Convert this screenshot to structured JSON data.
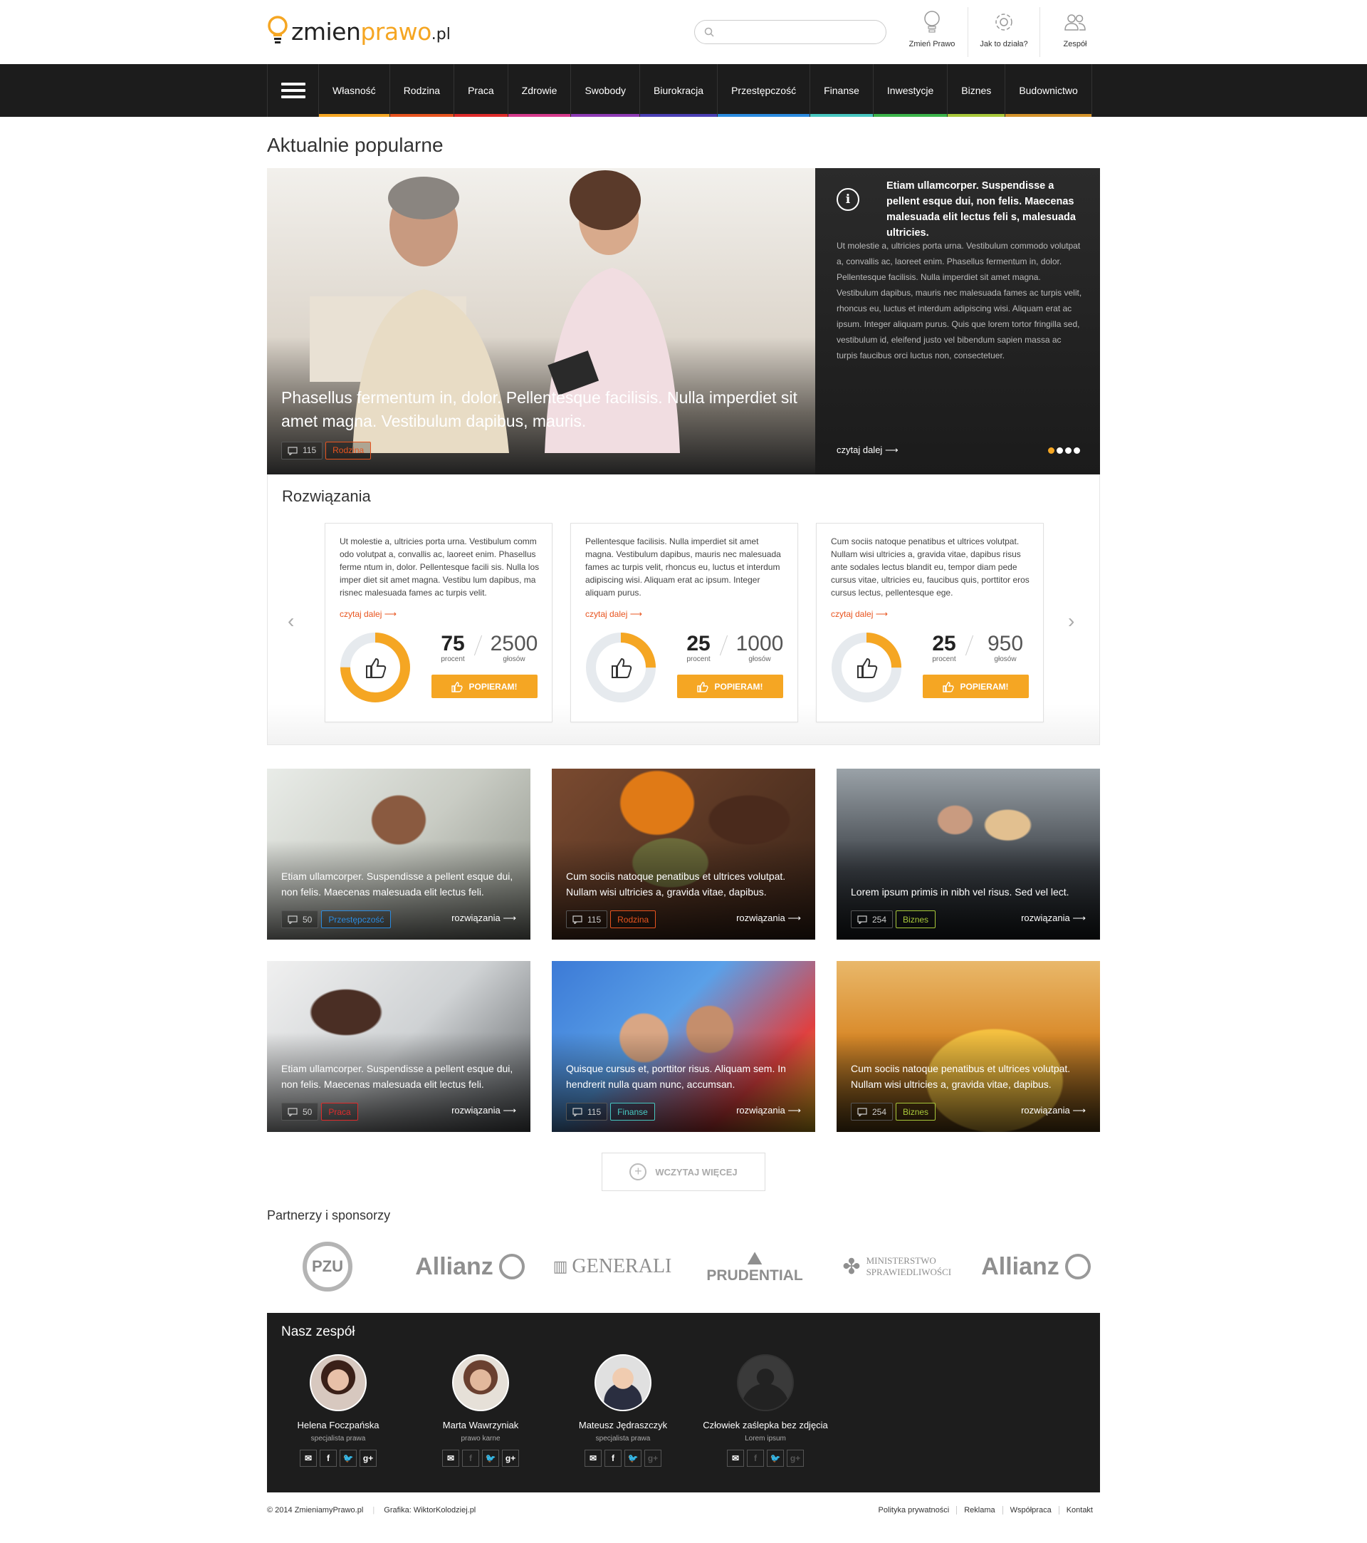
{
  "header": {
    "logo": {
      "part1": "zmien",
      "part2": "prawo",
      "part3": ".pl"
    },
    "search": {
      "placeholder": ""
    },
    "icons": [
      {
        "label": "Zmień Prawo",
        "icon": "lightbulb-icon"
      },
      {
        "label": "Jak to działa?",
        "icon": "gear-icon"
      },
      {
        "label": "Zespół",
        "icon": "people-icon"
      }
    ]
  },
  "nav": {
    "items": [
      {
        "label": "Własność",
        "color": "#f5a623"
      },
      {
        "label": "Rodzina",
        "color": "#e8541f"
      },
      {
        "label": "Praca",
        "color": "#e02b2b"
      },
      {
        "label": "Zdrowie",
        "color": "#d63a8c"
      },
      {
        "label": "Swobody",
        "color": "#8e3bb5"
      },
      {
        "label": "Biurokracja",
        "color": "#4b3fb5"
      },
      {
        "label": "Przestępczość",
        "color": "#2b8be0"
      },
      {
        "label": "Finanse",
        "color": "#47c7c0"
      },
      {
        "label": "Inwestycje",
        "color": "#3cb44a"
      },
      {
        "label": "Biznes",
        "color": "#a8c83a"
      },
      {
        "label": "Budownictwo",
        "color": "#d4932b"
      }
    ]
  },
  "popular": {
    "title": "Aktualnie popularne",
    "caption": "Phasellus fermentum in, dolor. Pellentesque facilisis. Nulla imperdiet sit amet magna. Vestibulum dapibus, mauris.",
    "comments": "115",
    "category": "Rodzina",
    "category_color": "#e8541f",
    "panel_title": "Etiam ullamcorper. Suspendisse a pellent esque dui, non felis. Maecenas malesuada elit lectus feli s, malesuada ultricies.",
    "panel_body": "Ut molestie a, ultricies porta urna. Vestibulum commodo volutpat a, convallis ac, laoreet enim. Phasellus fermentum in, dolor. Pellentesque facilisis. Nulla imperdiet sit amet magna. Vestibulum dapibus, mauris nec malesuada fames ac turpis velit, rhoncus eu, luctus et interdum adipiscing wisi. Aliquam erat ac ipsum. Integer aliquam purus. Quis que lorem tortor fringilla sed, vestibulum id, eleifend justo vel bibendum sapien massa ac turpis faucibus orci luctus non, consectetuer.",
    "read_more": "czytaj dalej"
  },
  "solutions": {
    "title": "Rozwiązania",
    "cards": [
      {
        "text": "Ut molestie a, ultricies porta urna. Vestibulum comm odo volutpat a, convallis ac, laoreet enim. Phasellus ferme ntum in, dolor. Pellentesque facili sis. Nulla los imper diet sit amet magna. Vestibu lum dapibus, ma risnec malesuada fames ac turpis velit.",
        "more": "czytaj dalej",
        "percent": "75",
        "percent_label": "procent",
        "votes": "2500",
        "votes_label": "głosów",
        "button": "POPIERAM!",
        "fill": 0.75
      },
      {
        "text": "Pellentesque facilisis. Nulla imperdiet sit amet magna. Vestibulum dapibus, mauris nec malesuada fames ac turpis velit, rhoncus eu, luctus et interdum adipiscing wisi. Aliquam erat ac ipsum. Integer aliquam purus.",
        "more": "czytaj dalej",
        "percent": "25",
        "percent_label": "procent",
        "votes": "1000",
        "votes_label": "głosów",
        "button": "POPIERAM!",
        "fill": 0.25
      },
      {
        "text": "Cum sociis natoque penatibus et ultrices volutpat. Nullam wisi ultricies a, gravida vitae, dapibus risus ante sodales lectus blandit eu, tempor diam pede cursus vitae, ultricies eu, faucibus quis, porttitor eros cursus lectus, pellentesque ege.",
        "more": "czytaj dalej",
        "percent": "25",
        "percent_label": "procent",
        "votes": "950",
        "votes_label": "głosów",
        "button": "POPIERAM!",
        "fill": 0.25
      }
    ]
  },
  "tiles": [
    {
      "title": "Etiam ullamcorper. Suspendisse a pellent esque dui, non felis. Maecenas malesuada elit lectus feli.",
      "comments": "50",
      "category": "Przestępczość",
      "color": "#2b8be0",
      "link": "rozwiązania"
    },
    {
      "title": "Cum sociis natoque penatibus et ultrices volutpat. Nullam wisi ultricies a, gravida vitae, dapibus.",
      "comments": "115",
      "category": "Rodzina",
      "color": "#e8541f",
      "link": "rozwiązania"
    },
    {
      "title": "Lorem ipsum primis in nibh vel risus. Sed vel lect.",
      "comments": "254",
      "category": "Biznes",
      "color": "#a8c83a",
      "link": "rozwiązania"
    },
    {
      "title": "Etiam ullamcorper. Suspendisse a pellent esque dui, non felis. Maecenas malesuada elit lectus feli.",
      "comments": "50",
      "category": "Praca",
      "color": "#e02b2b",
      "link": "rozwiązania"
    },
    {
      "title": "Quisque cursus et, porttitor risus. Aliquam sem. In hendrerit nulla quam nunc, accumsan.",
      "comments": "115",
      "category": "Finanse",
      "color": "#47c7c0",
      "link": "rozwiązania"
    },
    {
      "title": "Cum sociis natoque penatibus et ultrices volutpat. Nullam wisi ultricies a, gravida vitae, dapibus.",
      "comments": "254",
      "category": "Biznes",
      "color": "#a8c83a",
      "link": "rozwiązania"
    }
  ],
  "load_more": "WCZYTAJ WIĘCEJ",
  "partners": {
    "title": "Partnerzy i sponsorzy",
    "logos": [
      "PZU",
      "Allianz",
      "GENERALI",
      "PRUDENTIAL",
      "Ministerstwo Sprawiedliwości",
      "Allianz"
    ]
  },
  "team": {
    "title": "Nasz zespół",
    "members": [
      {
        "name": "Helena Foczpańska",
        "role": "specjalista prawa"
      },
      {
        "name": "Marta Wawrzyniak",
        "role": "prawo karne"
      },
      {
        "name": "Mateusz Jędraszczyk",
        "role": "specjalista prawa"
      },
      {
        "name": "Człowiek zaślepka bez zdjęcia",
        "role": "Lorem ipsum"
      }
    ]
  },
  "footer": {
    "copy": "© 2014 ZmieniamyPrawo.pl",
    "credit": "Grafika: WiktorKolodziej.pl",
    "links": [
      "Polityka prywatności",
      "Reklama",
      "Współpraca",
      "Kontakt"
    ]
  }
}
